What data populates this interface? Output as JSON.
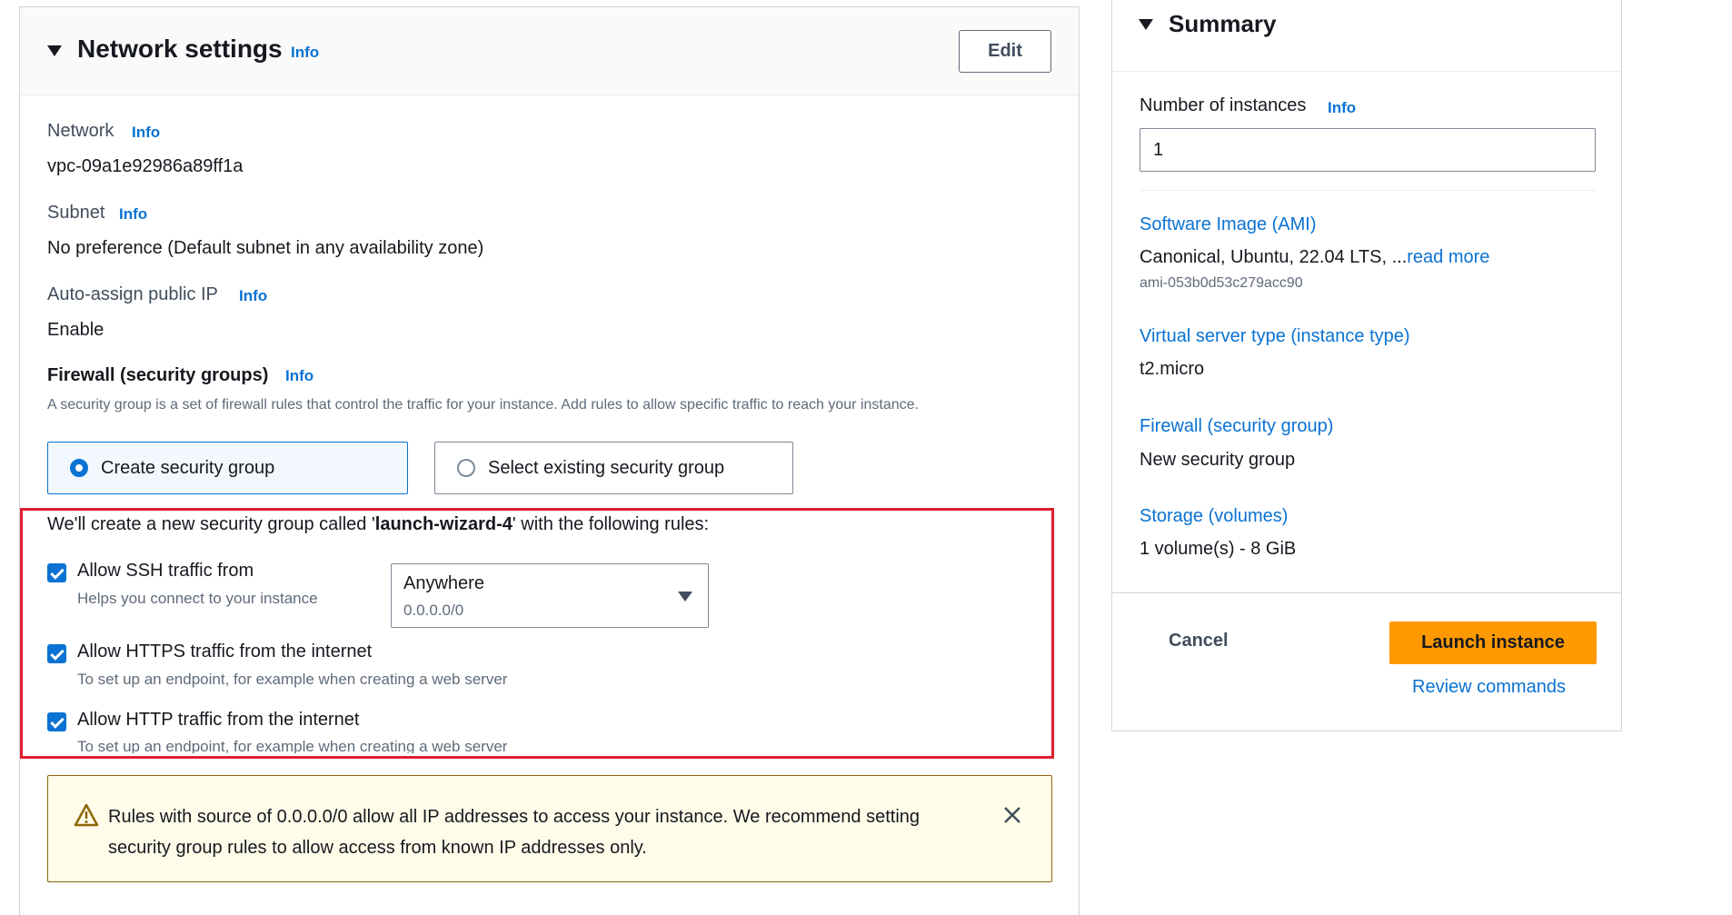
{
  "network_settings": {
    "title": "Network settings",
    "info": "Info",
    "edit_label": "Edit",
    "network": {
      "label": "Network",
      "info": "Info",
      "value": "vpc-09a1e92986a89ff1a"
    },
    "subnet": {
      "label": "Subnet",
      "info": "Info",
      "value": "No preference (Default subnet in any availability zone)"
    },
    "public_ip": {
      "label": "Auto-assign public IP",
      "info": "Info",
      "value": "Enable"
    },
    "firewall": {
      "label": "Firewall (security groups)",
      "info": "Info",
      "description": "A security group is a set of firewall rules that control the traffic for your instance. Add rules to allow specific traffic to reach your instance.",
      "options": [
        {
          "label": "Create security group",
          "selected": true
        },
        {
          "label": "Select existing security group",
          "selected": false
        }
      ]
    },
    "rules": {
      "intro_prefix": "We'll create a new security group called '",
      "group_name": "launch-wizard-4",
      "intro_suffix": "' with the following rules:",
      "ssh": {
        "label": "Allow SSH traffic from",
        "help": "Helps you connect to your instance",
        "checked": true,
        "select_value": "Anywhere",
        "select_sub": "0.0.0.0/0"
      },
      "https": {
        "label": "Allow HTTPS traffic from the internet",
        "help": "To set up an endpoint, for example when creating a web server",
        "checked": true
      },
      "http": {
        "label": "Allow HTTP traffic from the internet",
        "help": "To set up an endpoint, for example when creating a web server",
        "checked": true
      }
    },
    "warning": {
      "line1": "Rules with source of 0.0.0.0/0 allow all IP addresses to access your instance. We recommend setting",
      "line2": "security group rules to allow access from known IP addresses only."
    }
  },
  "summary": {
    "title": "Summary",
    "instances_label": "Number of instances",
    "instances_info": "Info",
    "instances_value": "1",
    "ami": {
      "label": "Software Image (AMI)",
      "value": "Canonical, Ubuntu, 22.04 LTS, ...",
      "read_more": "read more",
      "id": "ami-053b0d53c279acc90"
    },
    "instance_type": {
      "label": "Virtual server type (instance type)",
      "value": "t2.micro"
    },
    "firewall": {
      "label": "Firewall (security group)",
      "value": "New security group"
    },
    "storage": {
      "label": "Storage (volumes)",
      "value": "1 volume(s) - 8 GiB"
    },
    "cancel_label": "Cancel",
    "launch_label": "Launch instance",
    "review_label": "Review commands"
  },
  "colors": {
    "accent": "#0972d3",
    "launch": "#ff9900",
    "highlight": "#e0202f",
    "warning_bg": "#fffce9"
  }
}
